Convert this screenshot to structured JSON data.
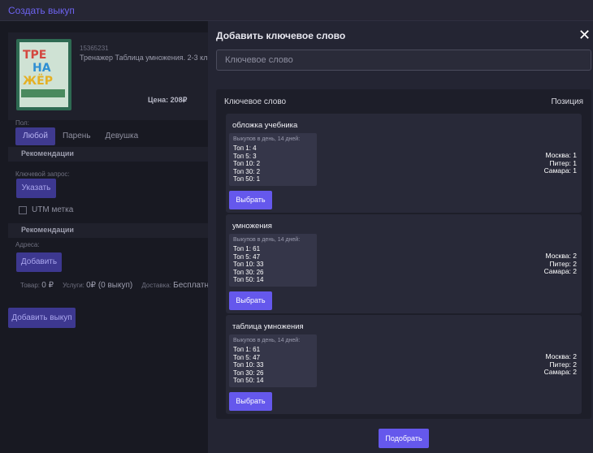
{
  "topbar": {
    "title": "Создать выкуп"
  },
  "product": {
    "cover_lines": [
      "ТРЕ",
      "НА",
      "ЖЁР"
    ],
    "article": "15365231",
    "name": "Тренажер Таблица умножения. 2-3 класс",
    "price": "Цена: 208₽"
  },
  "form": {
    "gender_label": "Пол:",
    "gender_options": [
      "Любой",
      "Парень",
      "Девушка"
    ],
    "gender_selected": "Любой",
    "recs_title_1": "Рекомендации",
    "keyword_label": "Ключевой запрос:",
    "specify_button": "Указать",
    "utm_label": "UTM метка",
    "recs_title_2": "Рекомендации",
    "address_label": "Адреса:",
    "add_button": "Добавить",
    "summary": {
      "goods_label": "Товар:",
      "goods_value": "0 ₽",
      "services_label": "Услуги:",
      "services_value": "0₽ (0 выкуп)",
      "delivery_label": "Доставка:",
      "delivery_value": "Бесплатно"
    },
    "add_buyout_button": "Добавить выкуп"
  },
  "modal": {
    "title": "Добавить ключевое слово",
    "close_glyph": "✕",
    "input_placeholder": "Ключевое слово",
    "col_keyword": "Ключевое слово",
    "col_position": "Позиция",
    "pick_label": "Выбрать",
    "submit_label": "Подобрать",
    "keywords": [
      {
        "name": "обложка учебника",
        "caption": "Выкупов в день, 14 дней:",
        "lines": [
          "Топ 1: 4",
          "Топ 5: 3",
          "Топ 10: 2",
          "Топ 30: 2",
          "Топ 50: 1"
        ],
        "cities": [
          "Москва: 1",
          "Питер: 1",
          "Самара: 1"
        ]
      },
      {
        "name": "умножения",
        "caption": "Выкупов в день, 14 дней:",
        "lines": [
          "Топ 1: 61",
          "Топ 5: 47",
          "Топ 10: 33",
          "Топ 30: 26",
          "Топ 50: 14"
        ],
        "cities": [
          "Москва: 2",
          "Питер: 2",
          "Самара: 2"
        ]
      },
      {
        "name": "таблица умножения",
        "caption": "Выкупов в день, 14 дней:",
        "lines": [
          "Топ 1: 61",
          "Топ 5: 47",
          "Топ 10: 33",
          "Топ 30: 26",
          "Топ 50: 14"
        ],
        "cities": [
          "Москва: 2",
          "Питер: 2",
          "Самара: 2"
        ]
      }
    ]
  }
}
